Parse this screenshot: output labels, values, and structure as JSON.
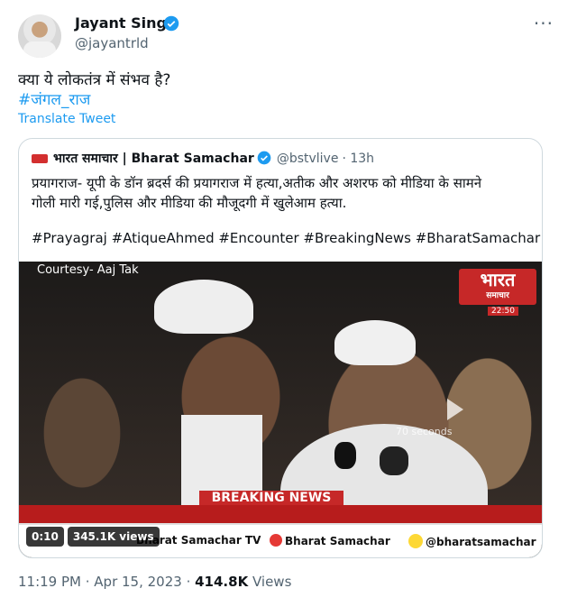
{
  "author": {
    "name": "Jayant Singh",
    "handle": "@jayantrld"
  },
  "tweet": {
    "text": "क्या ये लोकतंत्र में संभव है?",
    "hashtag": "#जंगल_राज",
    "translate_label": "Translate Tweet"
  },
  "quoted": {
    "source_name": "भारत समाचार | Bharat Samachar",
    "handle": "@bstvlive",
    "time": "· 13h",
    "text": "प्रयागराज- यूपी के डॉन ब्रदर्स की प्रयागराज में हत्या,अतीक और अशरफ को मीडिया के सामने\nगोली मारी गई,पुलिस और मीडिया की मौजूदगी में खुलेआम हत्या.",
    "hashtags": "#Prayagraj #AtiqueAhmed #Encounter #BreakingNews #BharatSamachar"
  },
  "video": {
    "courtesy": "Courtesy- Aaj Tak",
    "channel_logo": "भारत",
    "channel_logo_sub": "समाचार",
    "channel_time": "22:50",
    "overlay_seconds": "70 seconds",
    "breaking_label": "BREAKING NEWS",
    "bottom_tv": "Bharat Samachar TV",
    "bottom_youtube": "Bharat Samachar",
    "bottom_snapchat": "@bharatsamachar",
    "time_pill": "0:10",
    "views_pill": "345.1K views"
  },
  "meta": {
    "timestamp": "11:19 PM · Apr 15, 2023 ·",
    "views_count": "414.8K",
    "views_label": "Views"
  },
  "colors": {
    "accent": "#1d9bf0",
    "brand_red": "#c62828"
  }
}
